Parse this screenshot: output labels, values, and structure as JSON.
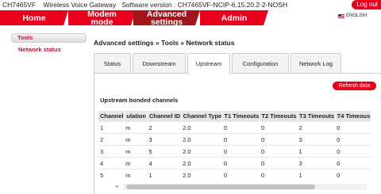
{
  "header": {
    "device": "CH7465VF",
    "product": "Wireless Voice Gateway",
    "software_label": "Software version :",
    "software_version": "CH7465VF-NCIP-6.15.20.2-2-NOSH",
    "logout": "Log out",
    "language": "ENGLISH"
  },
  "nav": {
    "home": "Home",
    "modem_line1": "Modem",
    "modem_line2": "mode",
    "advanced_line1": "Advanced",
    "advanced_line2": "settings",
    "admin": "Admin"
  },
  "sidebar": {
    "section": "Tools",
    "items": [
      {
        "label": "Network status"
      }
    ]
  },
  "breadcrumb": "Advanced settings » Tools » Network status",
  "tabs": [
    "Status",
    "Downstream",
    "Upstream",
    "Configuration",
    "Network Log"
  ],
  "active_tab": "Upstream",
  "refresh_label": "Refresh data",
  "section_title": "Upstream bonded channels",
  "table": {
    "headers": [
      "Channel",
      "ulation",
      "Channel ID",
      "Channel Type",
      "T1 Timeouts",
      "T2 Timeouts",
      "T3 Timeouts",
      "T4 Timeous"
    ],
    "rows": [
      [
        "1",
        "m",
        "2",
        "2.0",
        "0",
        "0",
        "2",
        "0"
      ],
      [
        "2",
        "m",
        "3",
        "2.0",
        "0",
        "0",
        "3",
        "0"
      ],
      [
        "3",
        "m",
        "5",
        "2.0",
        "0",
        "0",
        "1",
        "0"
      ],
      [
        "4",
        "m",
        "4",
        "2.0",
        "0",
        "0",
        "3",
        "0"
      ],
      [
        "5",
        "m",
        "1",
        "2.0",
        "0",
        "0",
        "1",
        "0"
      ]
    ]
  },
  "colors": {
    "brand_red": "#e8001c",
    "active_red": "#a3141b"
  }
}
